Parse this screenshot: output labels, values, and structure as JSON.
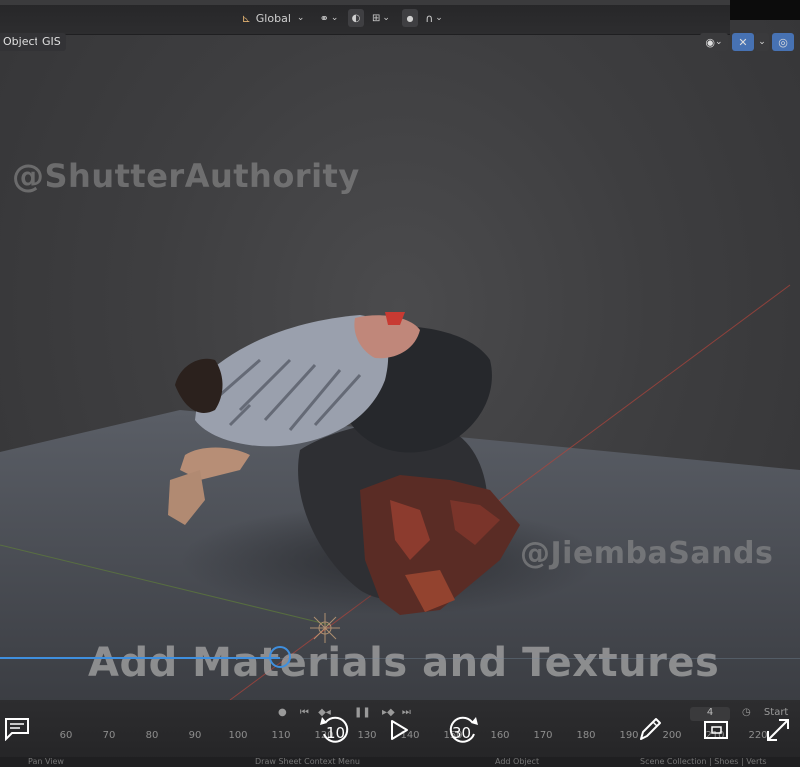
{
  "header": {
    "orientation_label": "Global",
    "mode_label": "Object",
    "menu_gis": "GIS"
  },
  "watermarks": {
    "top_left": "@ShutterAuthority",
    "right": "@JiembaSands"
  },
  "caption": "Add Materials and Textures",
  "timeline": {
    "frame_numbers": [
      "60",
      "70",
      "80",
      "90",
      "100",
      "110",
      "120",
      "130",
      "140",
      "150",
      "160",
      "170",
      "180",
      "190",
      "200",
      "210",
      "220"
    ],
    "current_frame": "4",
    "start_label": "Start"
  },
  "status_bar": {
    "left": "Pan View",
    "center": "Draw Sheet Context Menu",
    "center2": "Add Object",
    "right": "Scene Collection | Shoes | Verts"
  },
  "player": {
    "progress": 0.35,
    "skip_back": "10",
    "skip_forward": "30"
  },
  "colors": {
    "accent": "#3f8fde",
    "header": "#2a2a2c"
  }
}
